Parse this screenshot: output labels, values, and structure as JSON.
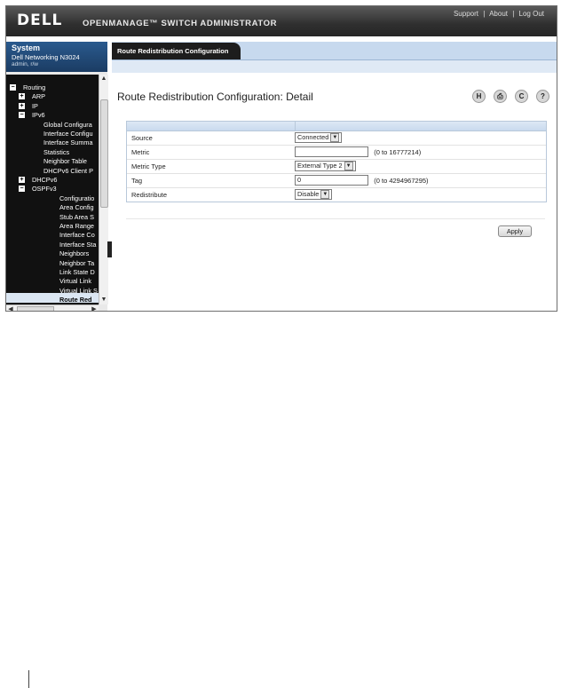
{
  "header": {
    "logo": "DELL",
    "app_title": "OPENMANAGE™ SWITCH ADMINISTRATOR",
    "links": [
      "Support",
      "About",
      "Log Out"
    ],
    "link_separator": "|"
  },
  "sidebar": {
    "system_title": "System",
    "device": "Dell Networking N3024",
    "user": "admin, r/w",
    "tree": [
      {
        "label": "Routing",
        "expander": "−",
        "level": 0
      },
      {
        "label": "ARP",
        "expander": "+",
        "level": 1
      },
      {
        "label": "IP",
        "expander": "+",
        "level": 1
      },
      {
        "label": "IPv6",
        "expander": "−",
        "level": 1
      },
      {
        "label": "Global Configura",
        "level": 2
      },
      {
        "label": "Interface Configu",
        "level": 2
      },
      {
        "label": "Interface Summa",
        "level": 2
      },
      {
        "label": "Statistics",
        "level": 2
      },
      {
        "label": "Neighbor Table",
        "level": 2
      },
      {
        "label": "DHCPv6 Client P",
        "level": 2
      },
      {
        "label": "DHCPv6",
        "expander": "+",
        "level": 1
      },
      {
        "label": "OSPFv3",
        "expander": "−",
        "level": 1
      },
      {
        "label": "Configuratio",
        "level": 3
      },
      {
        "label": "Area Config",
        "level": 3
      },
      {
        "label": "Stub Area S",
        "level": 3
      },
      {
        "label": "Area Range",
        "level": 3
      },
      {
        "label": "Interface Co",
        "level": 3
      },
      {
        "label": "Interface Sta",
        "level": 3
      },
      {
        "label": "Neighbors",
        "level": 3
      },
      {
        "label": "Neighbor Ta",
        "level": 3
      },
      {
        "label": "Link State D",
        "level": 3
      },
      {
        "label": "Virtual Link",
        "level": 3
      },
      {
        "label": "Virtual Link S",
        "level": 3
      },
      {
        "label": "Route Red",
        "level": 3,
        "selected": true
      }
    ]
  },
  "main": {
    "tab_label": "Route Redistribution Configuration",
    "page_title": "Route Redistribution Configuration: Detail",
    "toolbar_icons": [
      "save-icon",
      "print-icon",
      "refresh-icon",
      "help-icon"
    ],
    "toolbar_glyphs": [
      "H",
      "⎙",
      "C",
      "?"
    ],
    "form": {
      "source": {
        "label": "Source",
        "value": "Connected"
      },
      "metric": {
        "label": "Metric",
        "value": "",
        "hint": "(0 to 16777214)"
      },
      "metric_type": {
        "label": "Metric Type",
        "value": "External Type 2"
      },
      "tag": {
        "label": "Tag",
        "value": "0",
        "hint": "(0 to 4294967295)"
      },
      "redistribute": {
        "label": "Redistribute",
        "value": "Disable"
      }
    },
    "apply_label": "Apply"
  }
}
